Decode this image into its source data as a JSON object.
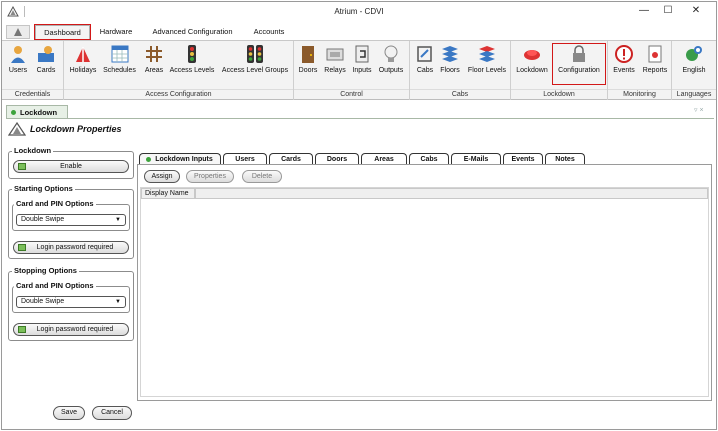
{
  "window": {
    "title": "Atrium - CDVI",
    "controls": [
      "—",
      "☐",
      "✕"
    ]
  },
  "ribbon_tabs": [
    "Dashboard",
    "Hardware",
    "Advanced Configuration",
    "Accounts"
  ],
  "ribbon": {
    "credentials": {
      "label": "Credentials",
      "buttons": [
        "Users",
        "Cards"
      ]
    },
    "access_configuration": {
      "label": "Access Configuration",
      "buttons": [
        "Holidays",
        "Schedules",
        "Areas",
        "Access Levels",
        "Access Level Groups"
      ]
    },
    "control": {
      "label": "Control",
      "buttons": [
        "Doors",
        "Relays",
        "Inputs",
        "Outputs"
      ]
    },
    "cabs": {
      "label": "Cabs",
      "buttons": [
        "Cabs",
        "Floors",
        "Floor Levels"
      ]
    },
    "lockdown": {
      "label": "Lockdown",
      "buttons": [
        "Lockdown",
        "Configuration"
      ]
    },
    "monitoring": {
      "label": "Monitoring",
      "buttons": [
        "Events",
        "Reports"
      ]
    },
    "languages": {
      "label": "Languages",
      "buttons": [
        "English"
      ]
    }
  },
  "doc_tab": {
    "label": "Lockdown",
    "controls": "▿ ×"
  },
  "pane_title": "Lockdown Properties",
  "lockdown_group": {
    "legend": "Lockdown",
    "enable_label": "Enable"
  },
  "starting_options": {
    "legend": "Starting Options",
    "card_pin_legend": "Card and PIN Options",
    "combo_value": "Double Swipe",
    "login_label": "Login password required"
  },
  "stopping_options": {
    "legend": "Stopping Options",
    "card_pin_legend": "Card and PIN Options",
    "combo_value": "Double Swipe",
    "login_label": "Login password required"
  },
  "content_tabs": [
    "Lockdown Inputs",
    "Users",
    "Cards",
    "Doors",
    "Areas",
    "Cabs",
    "E-Mails",
    "Events",
    "Notes"
  ],
  "toolbar": {
    "assign": "Assign",
    "properties": "Properties",
    "delete": "Delete"
  },
  "grid": {
    "columns": [
      "Display Name"
    ]
  },
  "footer": {
    "save": "Save",
    "cancel": "Cancel"
  }
}
